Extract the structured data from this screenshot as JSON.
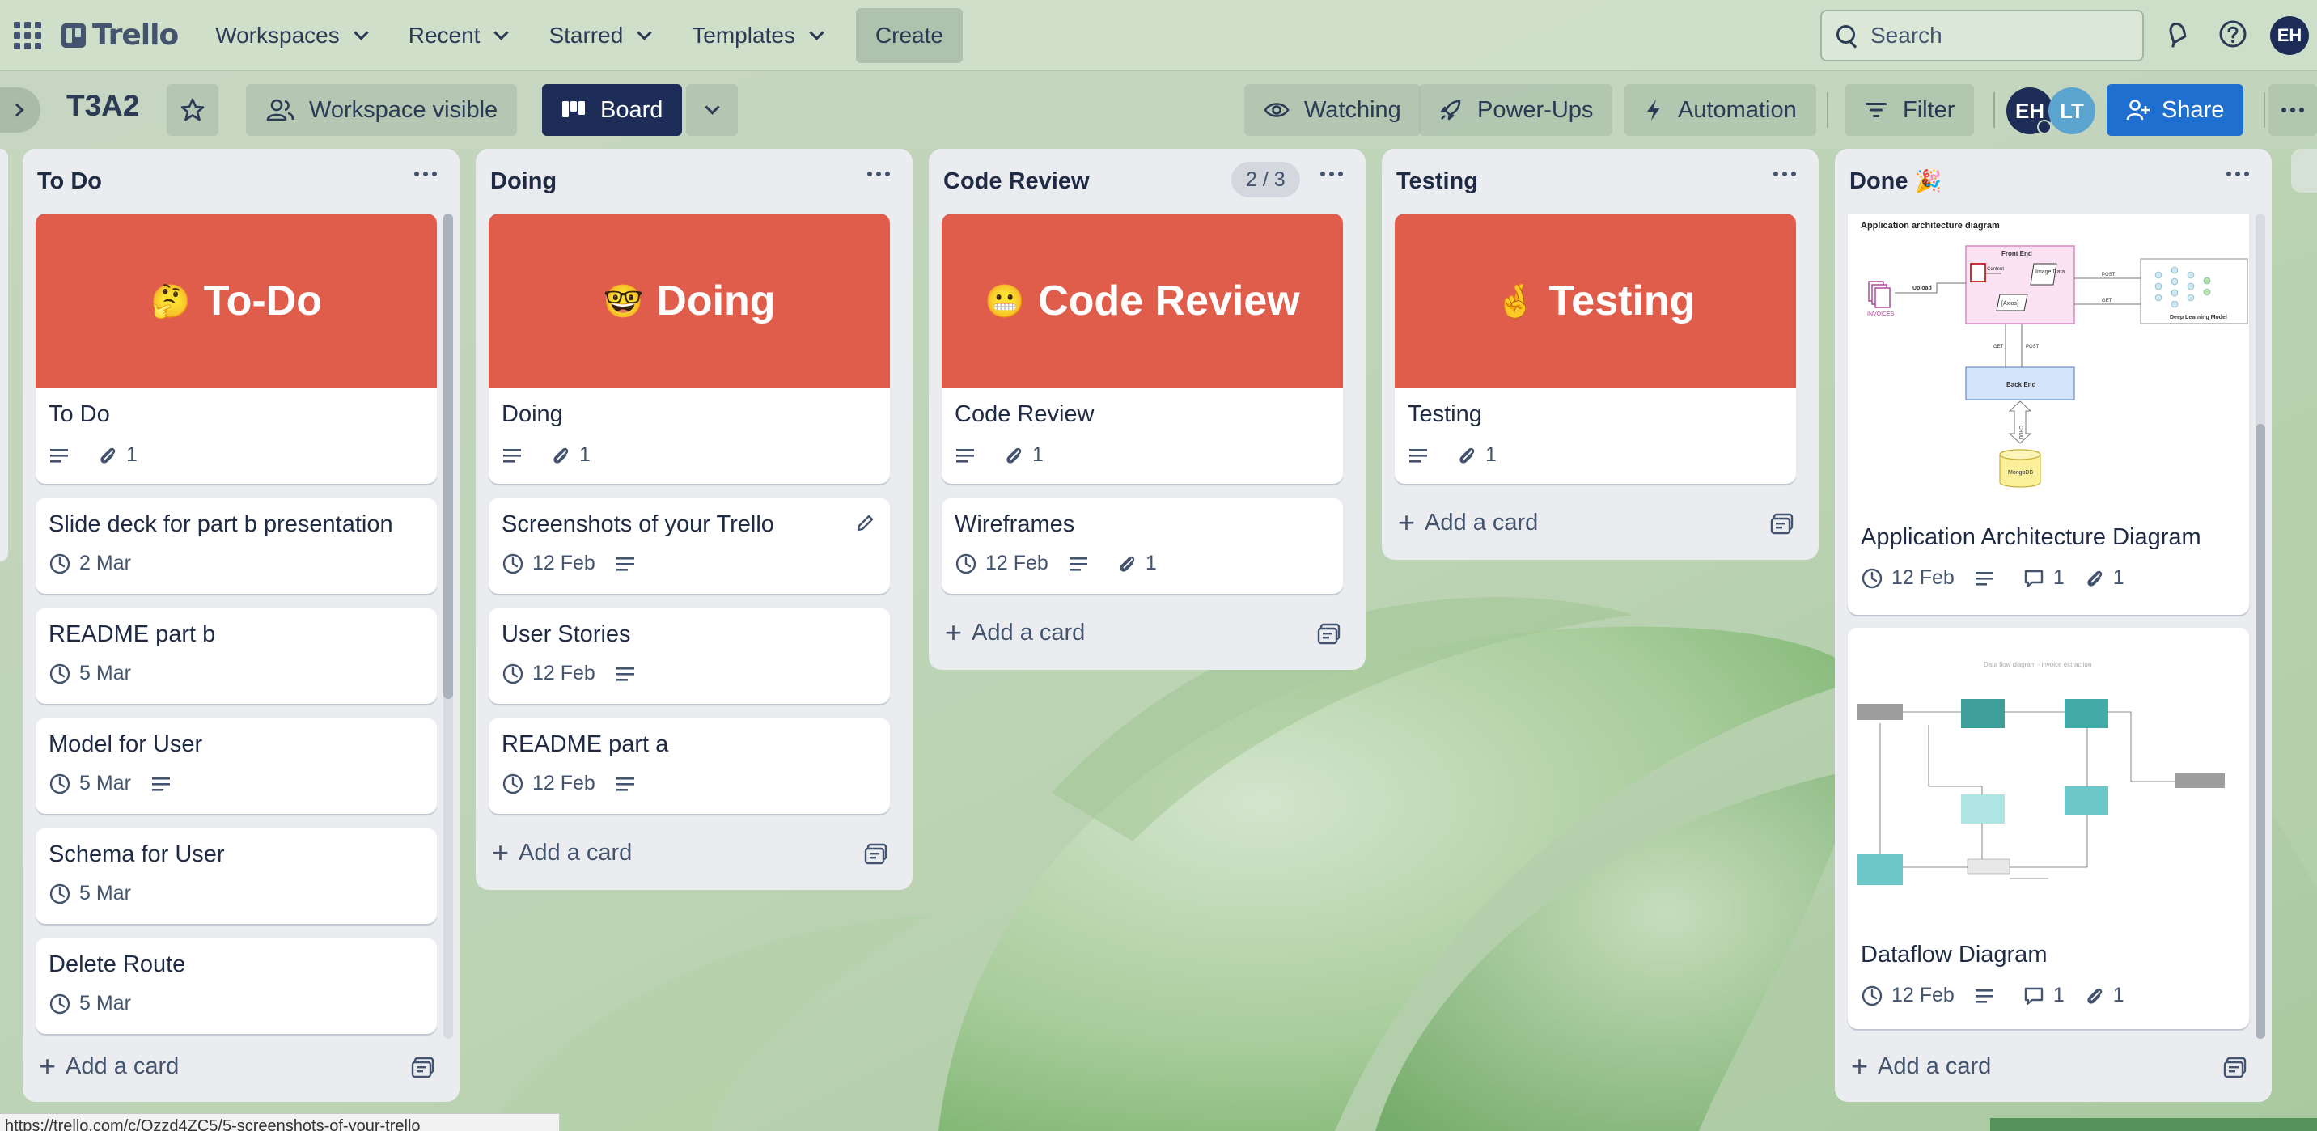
{
  "topnav": {
    "logo_text": "Trello",
    "menus": [
      "Workspaces",
      "Recent",
      "Starred",
      "Templates"
    ],
    "create_label": "Create",
    "search_placeholder": "Search",
    "user_initials": "EH"
  },
  "board": {
    "name": "T3A2",
    "visibility_label": "Workspace visible",
    "view_label": "Board",
    "watching_label": "Watching",
    "powerups_label": "Power-Ups",
    "automation_label": "Automation",
    "filter_label": "Filter",
    "members": [
      "EH",
      "LT"
    ],
    "share_label": "Share"
  },
  "lists": {
    "todo": {
      "title": "To Do",
      "cover_text": "To-Do",
      "cover_emoji": "🤔",
      "cards": [
        {
          "title": "To Do",
          "attachments": "1"
        },
        {
          "title": "Slide deck for part b presentation",
          "date": "2 Mar"
        },
        {
          "title": "README part b",
          "date": "5 Mar"
        },
        {
          "title": "Model for User",
          "date": "5 Mar"
        },
        {
          "title": "Schema for User",
          "date": "5 Mar"
        },
        {
          "title": "Delete Route",
          "date": "5 Mar"
        }
      ],
      "add_label": "Add a card"
    },
    "doing": {
      "title": "Doing",
      "cover_text": "Doing",
      "cover_emoji": "🤓",
      "cards": [
        {
          "title": "Doing",
          "attachments": "1"
        },
        {
          "title": "Screenshots of your Trello",
          "date": "12 Feb"
        },
        {
          "title": "User Stories",
          "date": "12 Feb"
        },
        {
          "title": "README part a",
          "date": "12 Feb"
        }
      ],
      "add_label": "Add a card"
    },
    "review": {
      "title": "Code Review",
      "count": "2 / 3",
      "cover_text": "Code Review",
      "cover_emoji": "😬",
      "cards": [
        {
          "title": "Code Review",
          "attachments": "1"
        },
        {
          "title": "Wireframes",
          "date": "12 Feb",
          "attachments": "1"
        }
      ],
      "add_label": "Add a card"
    },
    "testing": {
      "title": "Testing",
      "cover_text": "Testing",
      "cover_emoji": "🤞",
      "cards": [
        {
          "title": "Testing",
          "attachments": "1"
        }
      ],
      "add_label": "Add a card"
    },
    "done": {
      "title": "Done",
      "title_emoji": "🎉",
      "cards": [
        {
          "title": "Application Architecture Diagram",
          "date": "12 Feb",
          "comments": "1",
          "attachments": "1",
          "diagram": {
            "heading": "Application architecture diagram",
            "labels": [
              "Front End",
              "Upload",
              "Image Data",
              "POST",
              "GET",
              "[Axios]",
              "INVOICES",
              "Deep Learning Model",
              "Back End",
              "CRUD",
              "MongoDB"
            ]
          }
        },
        {
          "title": "Dataflow Diagram",
          "date": "12 Feb",
          "comments": "1",
          "attachments": "1",
          "diagram": {
            "heading": "Data flow diagram - invoice extraction"
          }
        }
      ],
      "add_label": "Add a card"
    }
  },
  "status_url": "https://trello.com/c/Qzzd4ZC5/5-screenshots-of-your-trello",
  "colors": {
    "cover_red": "#e05d4c",
    "share_blue": "#1f6fd0",
    "avatar_navy": "#1d2d57",
    "avatar_teal": "#5ba4cf",
    "diagram_teal": "#3eaaa8"
  }
}
